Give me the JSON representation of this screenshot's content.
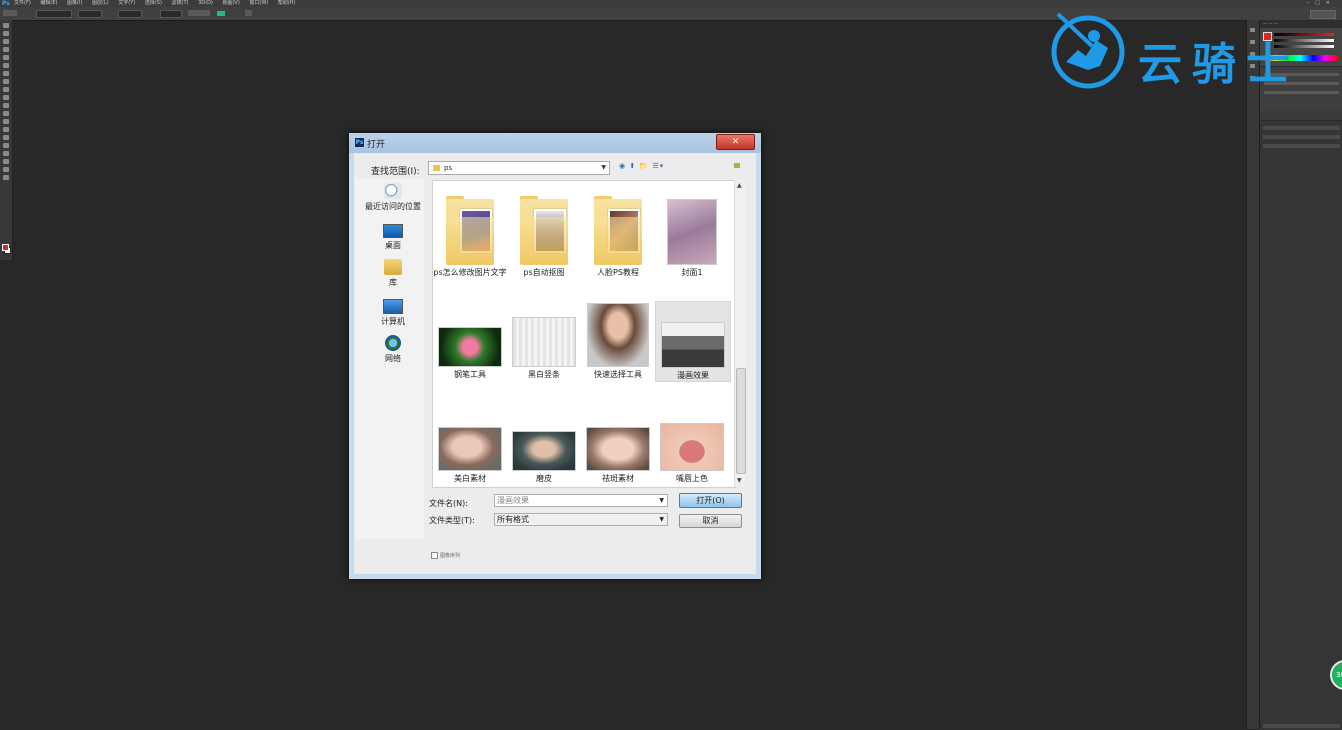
{
  "app": {
    "logo": "Ps"
  },
  "menubar": {
    "items": [
      "文件(F)",
      "编辑(E)",
      "图像(I)",
      "图层(L)",
      "文字(Y)",
      "选择(S)",
      "滤镜(T)",
      "3D(D)",
      "视图(V)",
      "窗口(W)",
      "帮助(H)"
    ]
  },
  "watermark": {
    "text": "云骑士"
  },
  "dialog": {
    "title": "打开",
    "close_label": "✕",
    "look_in_label": "查找范围(I):",
    "look_in_value": "ps",
    "places": [
      {
        "label": "最近访问的位置",
        "icon": "recent-places-icon"
      },
      {
        "label": "桌面",
        "icon": "desktop-icon"
      },
      {
        "label": "库",
        "icon": "library-icon"
      },
      {
        "label": "计算机",
        "icon": "computer-icon"
      },
      {
        "label": "网络",
        "icon": "network-icon"
      }
    ],
    "files": [
      {
        "name": "ps怎么修改图片文字",
        "type": "folder"
      },
      {
        "name": "ps自动抠图",
        "type": "folder"
      },
      {
        "name": "人脸PS教程",
        "type": "folder"
      },
      {
        "name": "封面1",
        "type": "image"
      },
      {
        "name": "钢笔工具",
        "type": "image"
      },
      {
        "name": "黑白竖条",
        "type": "image"
      },
      {
        "name": "快速选择工具",
        "type": "image"
      },
      {
        "name": "漫画效果",
        "type": "image",
        "selected": true
      },
      {
        "name": "美白素材",
        "type": "image"
      },
      {
        "name": "磨皮",
        "type": "image"
      },
      {
        "name": "祛斑素材",
        "type": "image"
      },
      {
        "name": "嘴唇上色",
        "type": "image"
      }
    ],
    "filename_label": "文件名(N):",
    "filename_value": "漫画效果",
    "filetype_label": "文件类型(T):",
    "filetype_value": "所有格式",
    "open_label": "打开(O)",
    "cancel_label": "取消",
    "image_sequence_label": "图像序列"
  },
  "colors": {
    "accent": "#1f9ae6",
    "foreground_swatch": "#e02525"
  }
}
